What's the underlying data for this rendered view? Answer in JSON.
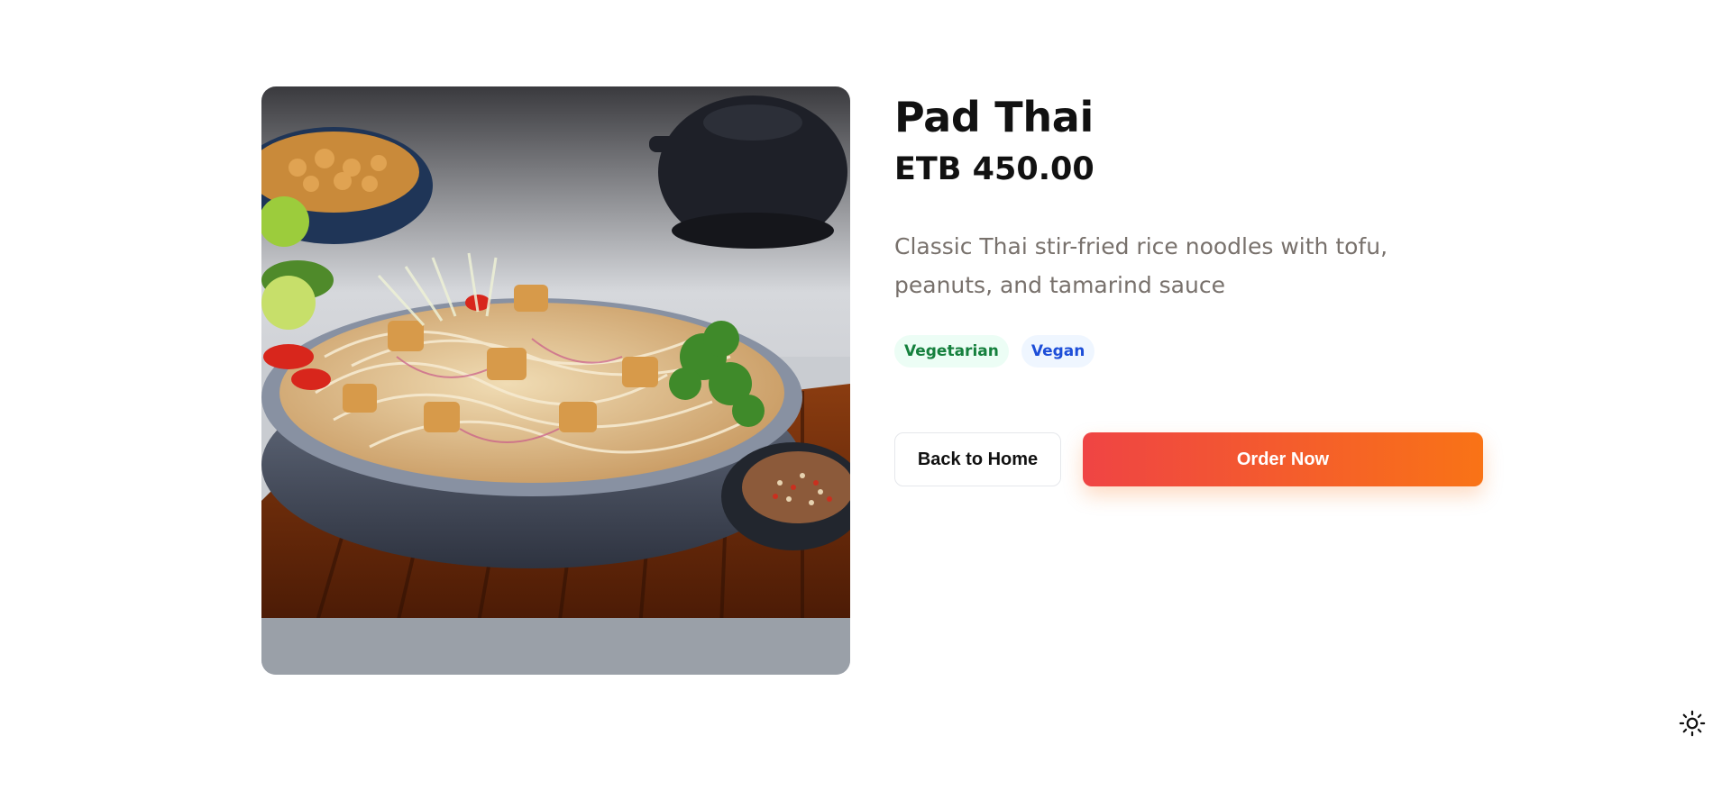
{
  "product": {
    "title": "Pad Thai",
    "price": "ETB 450.00",
    "description": "Classic Thai stir-fried rice noodles with tofu, peanuts, and tamarind sauce",
    "image_alt": "Pad Thai",
    "tags": [
      {
        "label": "Vegetarian"
      },
      {
        "label": "Vegan"
      }
    ]
  },
  "actions": {
    "back_label": "Back to Home",
    "order_label": "Order Now"
  },
  "theme_toggle": {
    "icon": "sun-icon"
  },
  "colors": {
    "accent_start": "#ef4444",
    "accent_end": "#f97316",
    "vegetarian_text": "#15803d",
    "vegan_text": "#1d4ed8"
  }
}
